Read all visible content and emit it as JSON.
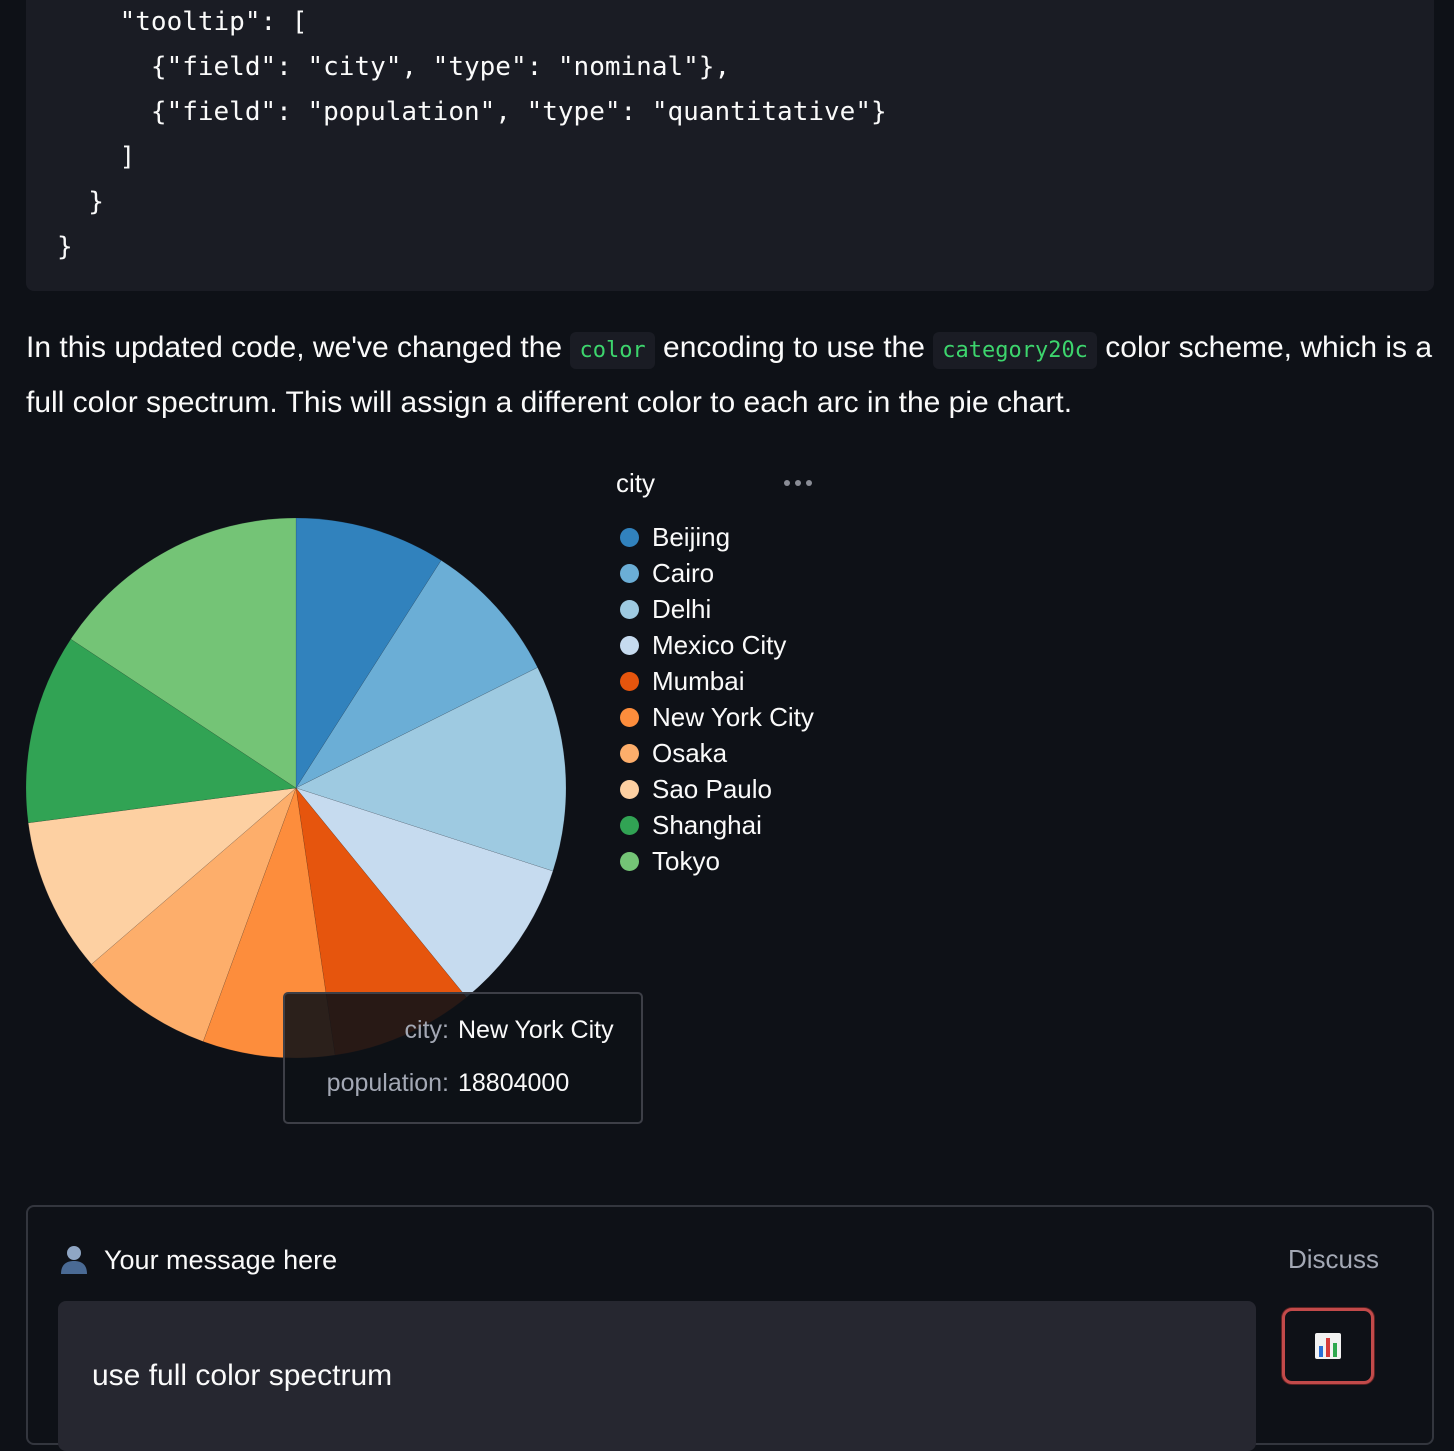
{
  "code": {
    "lines": [
      "    \"tooltip\": [",
      "      {\"field\": \"city\", \"type\": \"nominal\"},",
      "      {\"field\": \"population\", \"type\": \"quantitative\"}",
      "    ]",
      "  }",
      "}"
    ]
  },
  "paragraph": {
    "part1": "In this updated code, we've changed the ",
    "code1": "color",
    "part2": " encoding to use the ",
    "code2": "category20c",
    "part3": " color scheme, which is a full color spectrum. This will assign a different color to each arc in the pie chart."
  },
  "chart_data": {
    "type": "pie",
    "legend_title": "city",
    "legend_position": "right",
    "categories": [
      "Beijing",
      "Cairo",
      "Delhi",
      "Mexico City",
      "Mumbai",
      "New York City",
      "Osaka",
      "Sao Paulo",
      "Shanghai",
      "Tokyo"
    ],
    "values": [
      21516000,
      20485000,
      29399000,
      21782000,
      20411000,
      18804000,
      19281000,
      22043000,
      27058000,
      37400000
    ],
    "colors": [
      "#3182bd",
      "#6baed6",
      "#9ecae1",
      "#c6dbef",
      "#e6550d",
      "#fd8d3c",
      "#fdae6b",
      "#fdd0a2",
      "#31a354",
      "#74c476"
    ],
    "tooltip": {
      "city_label": "city:",
      "city_value": "New York City",
      "population_label": "population:",
      "population_value": "18804000"
    }
  },
  "chat": {
    "label": "Your message here",
    "discuss": "Discuss",
    "input_value": "use full color spectrum",
    "button_icon": "bar-chart-icon"
  }
}
